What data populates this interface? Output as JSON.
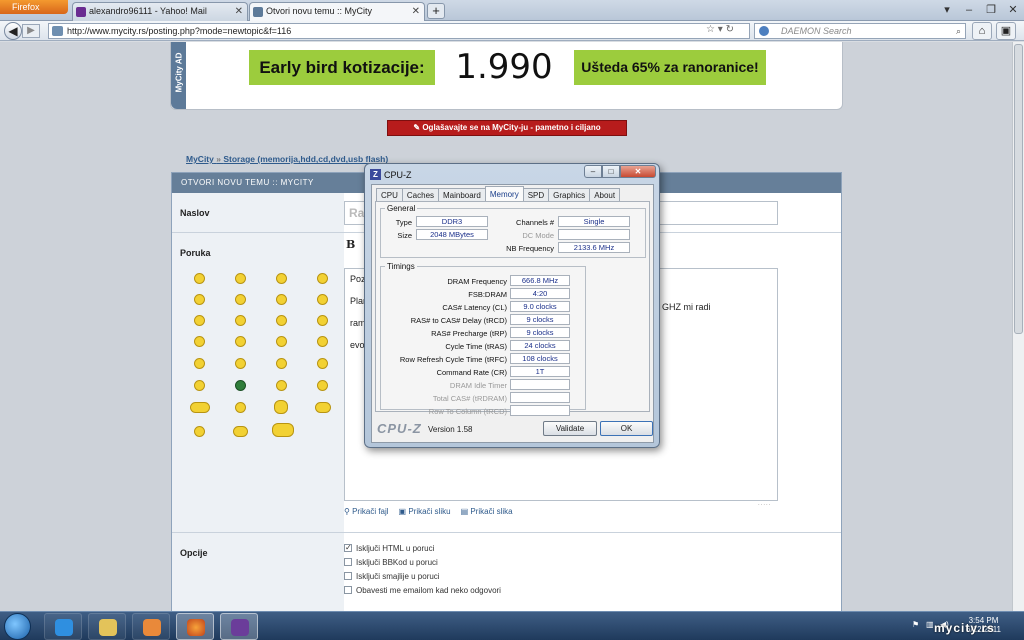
{
  "browser": {
    "app_button": "Firefox",
    "tabs": [
      {
        "label": "alexandro96111 - Yahoo! Mail",
        "color": "#6a2c91"
      },
      {
        "label": "Otvori novu temu :: MyCity",
        "color": "#5d7a99"
      }
    ],
    "new_tab": "+",
    "url": "http://www.mycity.rs/posting.php?mode=newtopic&f=116",
    "search_placeholder": "DAEMON Search"
  },
  "ad": {
    "side_label": "MyCity AD",
    "headline": "Early bird kotizacije:",
    "price": "1.990",
    "promo": "Ušteda 65% za ranoranice!",
    "link": "Oglašavajte se na MyCity-ju - pametno i ciljano"
  },
  "breadcrumb": {
    "home": "MyCity",
    "separator": "»",
    "forum": "Storage (memorija,hdd,cd,dvd,usb flash)"
  },
  "form": {
    "header": "OTVORI NOVU TEMU :: MYCITY",
    "title_label": "Naslov",
    "title_value": "Ra",
    "message_label": "Poruka",
    "bold_button": "B",
    "editor_lines": [
      "Poz",
      "Plan",
      "ram",
      "evo"
    ],
    "editor_right_line": "a koliko GHZ mi radi",
    "attach": [
      "Prikači fajl",
      "Prikači sliku",
      "Prikači slika"
    ],
    "options_label": "Opcije",
    "options": [
      {
        "label": "Isključi HTML u poruci",
        "checked": true
      },
      {
        "label": "Isključi BBKod u poruci",
        "checked": false
      },
      {
        "label": "Isključi smajlije u poruci",
        "checked": false
      },
      {
        "label": "Obavesti me emailom kad neko odgovori",
        "checked": false
      }
    ]
  },
  "cpuz": {
    "title": "CPU-Z",
    "icon_letter": "Z",
    "tabs": [
      "CPU",
      "Caches",
      "Mainboard",
      "Memory",
      "SPD",
      "Graphics",
      "About"
    ],
    "active_tab": "Memory",
    "general": {
      "legend": "General",
      "type_label": "Type",
      "type": "DDR3",
      "size_label": "Size",
      "size": "2048 MBytes",
      "channels_label": "Channels #",
      "channels": "Single",
      "dcmode_label": "DC Mode",
      "dcmode": "",
      "nbfreq_label": "NB Frequency",
      "nbfreq": "2133.6 MHz"
    },
    "timings_legend": "Timings",
    "timings": [
      {
        "label": "DRAM Frequency",
        "value": "666.8 MHz",
        "dim": false
      },
      {
        "label": "FSB:DRAM",
        "value": "4:20",
        "dim": false
      },
      {
        "label": "CAS# Latency (CL)",
        "value": "9.0 clocks",
        "dim": false
      },
      {
        "label": "RAS# to CAS# Delay (tRCD)",
        "value": "9 clocks",
        "dim": false
      },
      {
        "label": "RAS# Precharge (tRP)",
        "value": "9 clocks",
        "dim": false
      },
      {
        "label": "Cycle Time (tRAS)",
        "value": "24 clocks",
        "dim": false
      },
      {
        "label": "Row Refresh Cycle Time (tRFC)",
        "value": "108 clocks",
        "dim": false
      },
      {
        "label": "Command Rate (CR)",
        "value": "1T",
        "dim": false
      },
      {
        "label": "DRAM Idle Timer",
        "value": "",
        "dim": true
      },
      {
        "label": "Total CAS# (tRDRAM)",
        "value": "",
        "dim": true
      },
      {
        "label": "Row To Column (tRCD)",
        "value": "",
        "dim": true
      }
    ],
    "brand": "CPU-Z",
    "version": "Version 1.58",
    "validate": "Validate",
    "ok": "OK"
  },
  "taskbar": {
    "time": "3:54 PM",
    "date": "6/12/2011",
    "watermark": "mycity.rs"
  }
}
